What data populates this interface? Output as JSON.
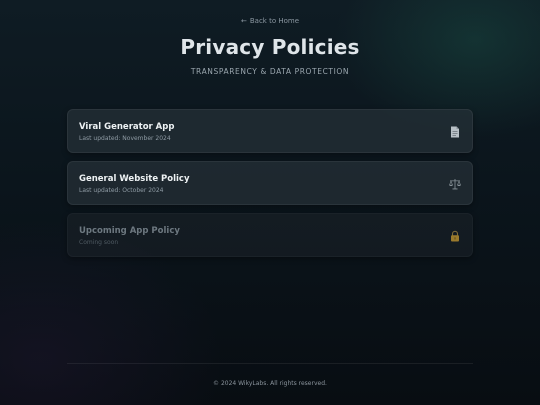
{
  "nav": {
    "back_arrow": "←",
    "back_label": "Back to Home"
  },
  "header": {
    "title": "Privacy Policies",
    "subtitle": "TRANSPARENCY & DATA PROTECTION"
  },
  "policies": [
    {
      "title": "Viral Generator App",
      "subtitle": "Last updated: November 2024",
      "icon": "document-icon",
      "enabled": true
    },
    {
      "title": "General Website Policy",
      "subtitle": "Last updated: October 2024",
      "icon": "scales-icon",
      "enabled": true
    },
    {
      "title": "Upcoming App Policy",
      "subtitle": "Coming soon",
      "icon": "lock-icon",
      "enabled": false
    }
  ],
  "footer": {
    "copyright": "© 2024 WikyLabs. All rights reserved."
  },
  "colors": {
    "background": "#0b151c",
    "card": "#262f36",
    "accent_lock": "#b08a2e"
  }
}
